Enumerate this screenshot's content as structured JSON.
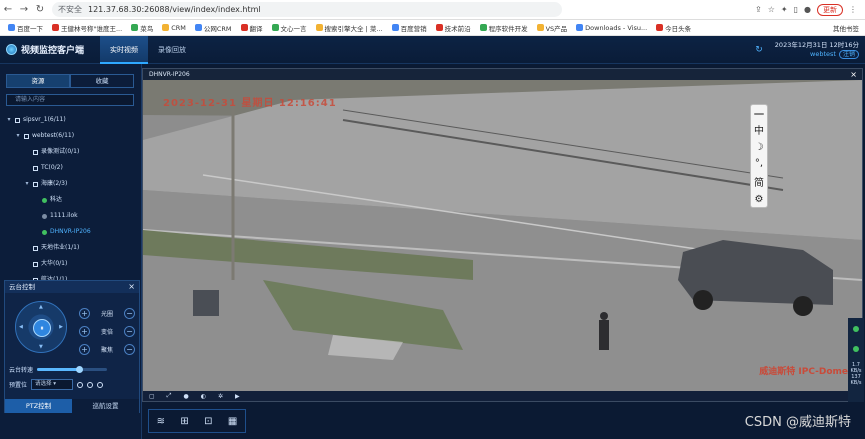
{
  "browser": {
    "security": "不安全",
    "url": "121.37.68.30:26088/view/index/index.html",
    "update": "更新"
  },
  "bookmarks": [
    "百度一下",
    "王健林号称\"谁度王...",
    "菜鸟",
    "CRM",
    "公网CRM",
    "翻译",
    "文心一言",
    "搜索引擎大全 | 菜...",
    "百度营销",
    "技术前沿",
    "程序软件开发",
    "VS产品",
    "Downloads - Visu...",
    "今日头条"
  ],
  "bookmarks_other": "其他书签",
  "app": {
    "title": "视频监控客户端",
    "tabs": [
      "实时视频",
      "录像回放"
    ],
    "datetime": "2023年12月31日 12时16分",
    "user": "webtest",
    "logout": "注销"
  },
  "sidebar": {
    "tabs": [
      "资源",
      "收藏"
    ],
    "search_placeholder": "请输入内容",
    "tree": [
      {
        "label": "sipsvr_1(6/11)",
        "level": 0,
        "kind": "folder",
        "expanded": true
      },
      {
        "label": "webtest(6/11)",
        "level": 1,
        "kind": "folder",
        "expanded": true
      },
      {
        "label": "录像测试(0/1)",
        "level": 2,
        "kind": "group"
      },
      {
        "label": "TC(0/2)",
        "level": 2,
        "kind": "group"
      },
      {
        "label": "海康(2/3)",
        "level": 2,
        "kind": "group",
        "expanded": true
      },
      {
        "label": "科达",
        "level": 3,
        "kind": "camera-online"
      },
      {
        "label": "1111.ilok",
        "level": 3,
        "kind": "camera-offline"
      },
      {
        "label": "DHNVR-IP206",
        "level": 3,
        "kind": "camera-online",
        "selected": true
      },
      {
        "label": "天地伟业(1/1)",
        "level": 2,
        "kind": "group"
      },
      {
        "label": "大华(0/1)",
        "level": 2,
        "kind": "group"
      },
      {
        "label": "航达(1/1)",
        "level": 2,
        "kind": "group"
      }
    ]
  },
  "ptz": {
    "title": "云台控制",
    "controls": [
      "光圈",
      "变倍",
      "聚焦"
    ],
    "speed_label": "云台转速",
    "speed_fraction": 0.6,
    "preset_label": "预置位",
    "preset_value": "请选择",
    "footer_tabs": [
      "PTZ控制",
      "巡航设置"
    ]
  },
  "video": {
    "title": "DHNVR-IP206",
    "osd_time": "2023-12-31 星期日 12:16:41",
    "watermark": "威迪斯特 IPC-Dome",
    "strip_values": [
      "1.7",
      "KB/s",
      "137",
      "KB/s"
    ]
  },
  "ime": [
    "中",
    "☽",
    "°,",
    "简",
    "⚙"
  ],
  "footer_watermark": "CSDN @威迪斯特"
}
